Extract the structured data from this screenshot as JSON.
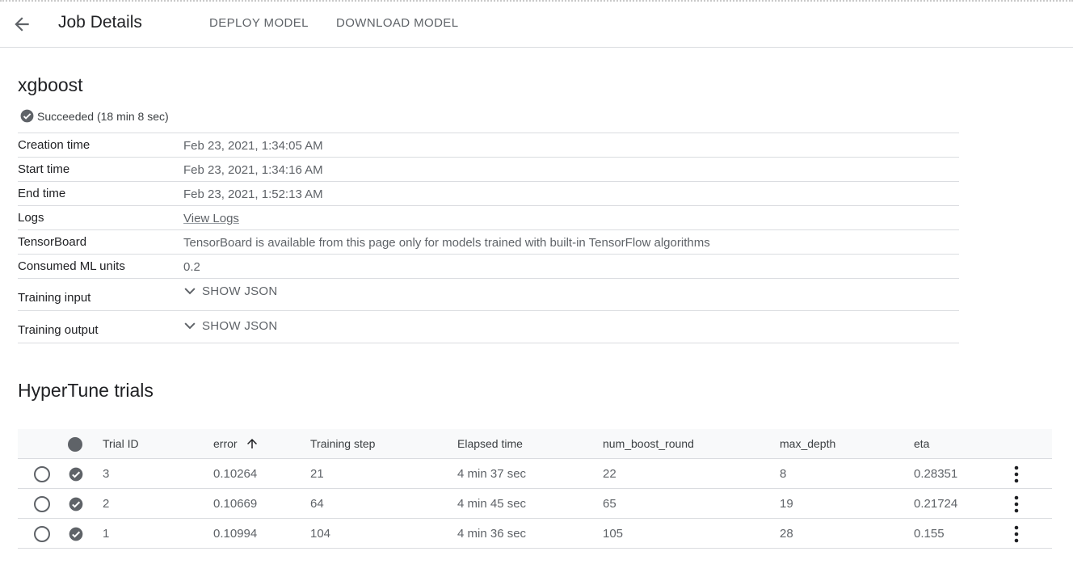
{
  "header": {
    "back_icon": "arrow-back-icon",
    "title": "Job Details",
    "deploy_label": "DEPLOY MODEL",
    "download_label": "DOWNLOAD MODEL"
  },
  "job": {
    "name": "xgboost",
    "status_icon": "check-circle-icon",
    "status_text": "Succeeded (18 min 8 sec)"
  },
  "details": [
    {
      "label": "Creation time",
      "value": "Feb 23, 2021, 1:34:05 AM"
    },
    {
      "label": "Start time",
      "value": "Feb 23, 2021, 1:34:16 AM"
    },
    {
      "label": "End time",
      "value": "Feb 23, 2021, 1:52:13 AM"
    },
    {
      "label": "Logs",
      "value": "View Logs"
    },
    {
      "label": "TensorBoard",
      "value": "TensorBoard is available from this page only for models trained with built-in TensorFlow algorithms"
    },
    {
      "label": "Consumed ML units",
      "value": "0.2"
    },
    {
      "label": "Training input",
      "value": "SHOW JSON"
    },
    {
      "label": "Training output",
      "value": "SHOW JSON"
    }
  ],
  "trials": {
    "title": "HyperTune trials",
    "columns": [
      "Trial ID",
      "error",
      "Training step",
      "Elapsed time",
      "num_boost_round",
      "max_depth",
      "eta"
    ],
    "sort_icon": "arrow-up-icon",
    "rows": [
      {
        "trial_id": "3",
        "error": "0.10264",
        "training_step": "21",
        "elapsed_time": "4 min 37 sec",
        "num_boost_round": "22",
        "max_depth": "8",
        "eta": "0.28351"
      },
      {
        "trial_id": "2",
        "error": "0.10669",
        "training_step": "64",
        "elapsed_time": "4 min 45 sec",
        "num_boost_round": "65",
        "max_depth": "19",
        "eta": "0.21724"
      },
      {
        "trial_id": "1",
        "error": "0.10994",
        "training_step": "104",
        "elapsed_time": "4 min 36 sec",
        "num_boost_round": "105",
        "max_depth": "28",
        "eta": "0.155"
      }
    ]
  }
}
